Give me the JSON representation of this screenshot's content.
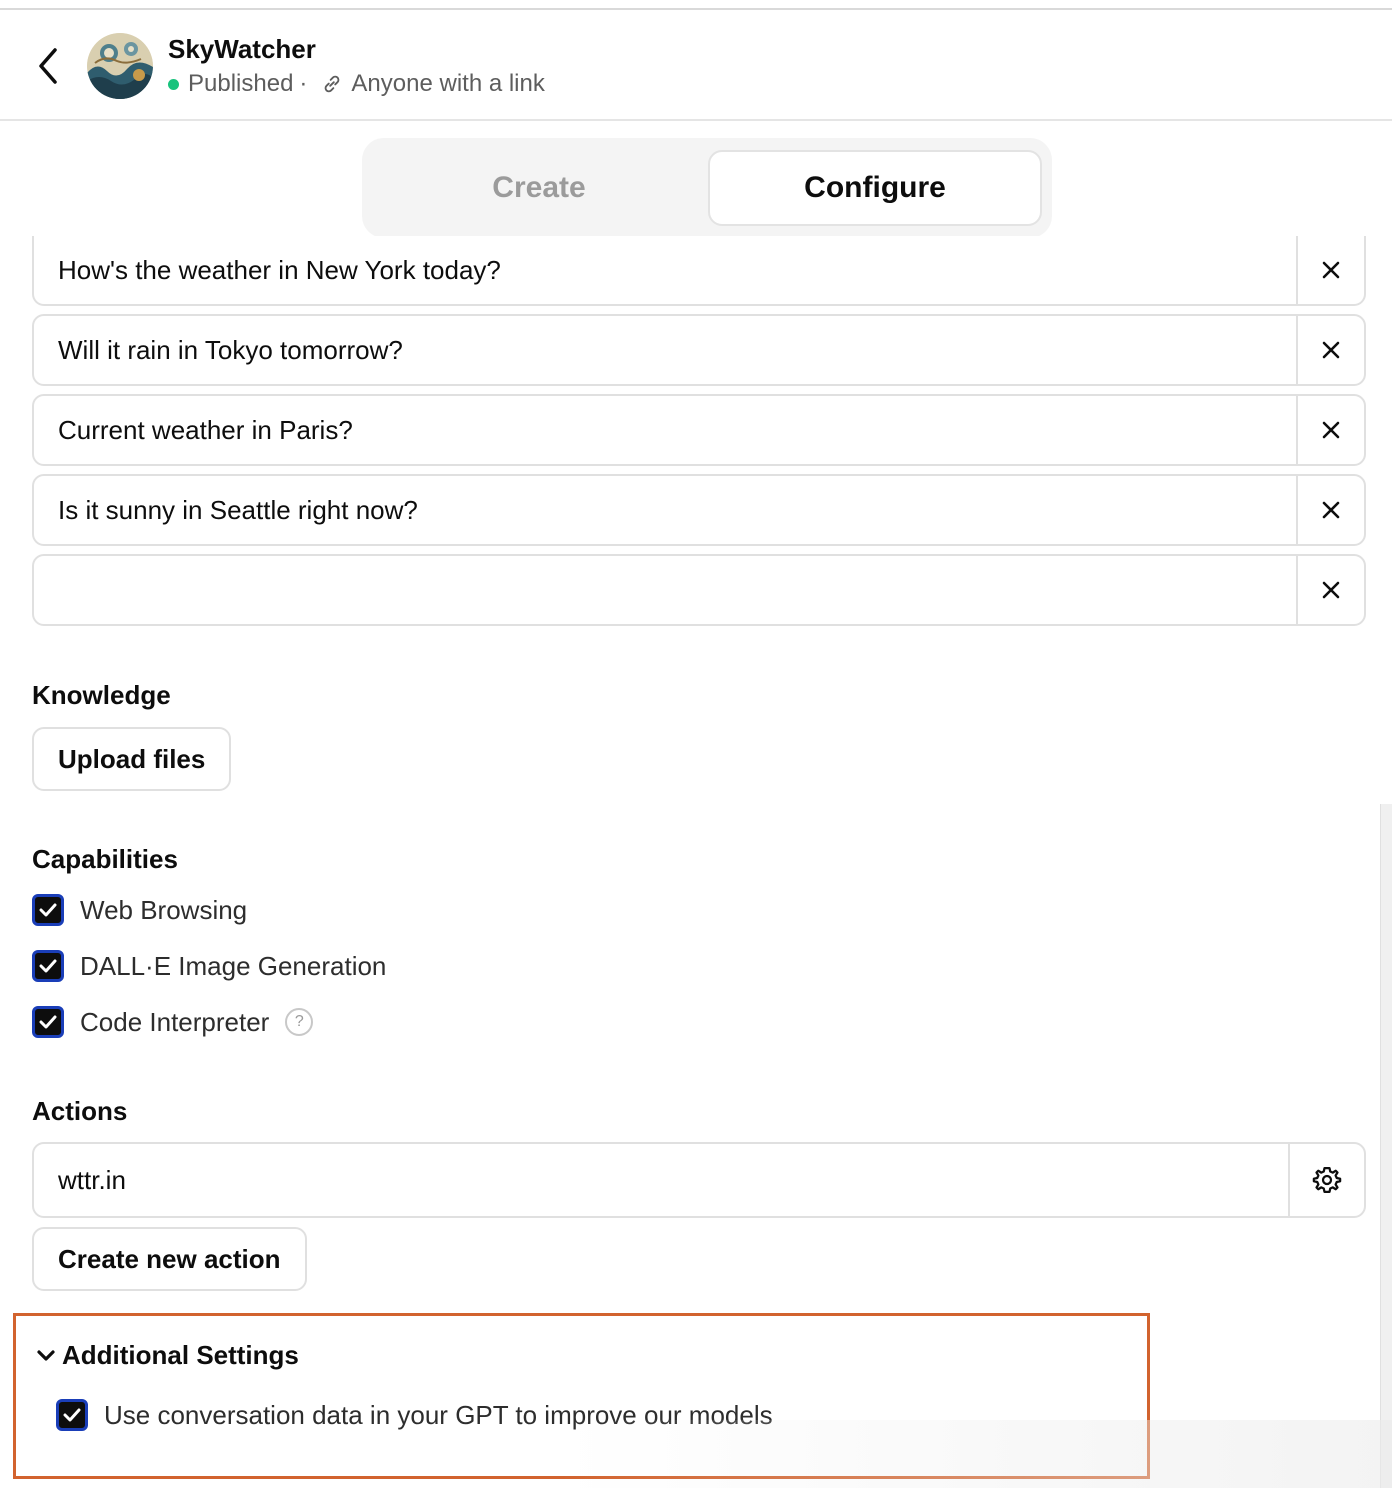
{
  "header": {
    "gpt_name": "SkyWatcher",
    "status": "Published",
    "separator": "·",
    "visibility": "Anyone with a link"
  },
  "tabs": [
    {
      "label": "Create",
      "active": false
    },
    {
      "label": "Configure",
      "active": true
    }
  ],
  "conversation_starters": [
    "How's the weather in New York today?",
    "Will it rain in Tokyo tomorrow?",
    "Current weather in Paris?",
    "Is it sunny in Seattle right now?",
    ""
  ],
  "knowledge": {
    "label": "Knowledge",
    "upload_label": "Upload files"
  },
  "capabilities": {
    "label": "Capabilities",
    "items": [
      {
        "label": "Web Browsing",
        "checked": true
      },
      {
        "label": "DALL·E Image Generation",
        "checked": true
      },
      {
        "label": "Code Interpreter",
        "checked": true,
        "help": "?"
      }
    ]
  },
  "actions": {
    "label": "Actions",
    "items": [
      {
        "name": "wttr.in"
      }
    ],
    "create_label": "Create new action"
  },
  "additional_settings": {
    "label": "Additional Settings",
    "expanded": true,
    "option_label": "Use conversation data in your GPT to improve our models",
    "option_checked": true
  },
  "colors": {
    "highlight": "#d2632e",
    "status_dot": "#19c37d",
    "checkbox_border": "#1a3eb8"
  },
  "icons": [
    "chevron-left-icon",
    "link-icon",
    "close-icon",
    "check-icon",
    "help-icon",
    "gear-icon",
    "chevron-down-icon"
  ]
}
